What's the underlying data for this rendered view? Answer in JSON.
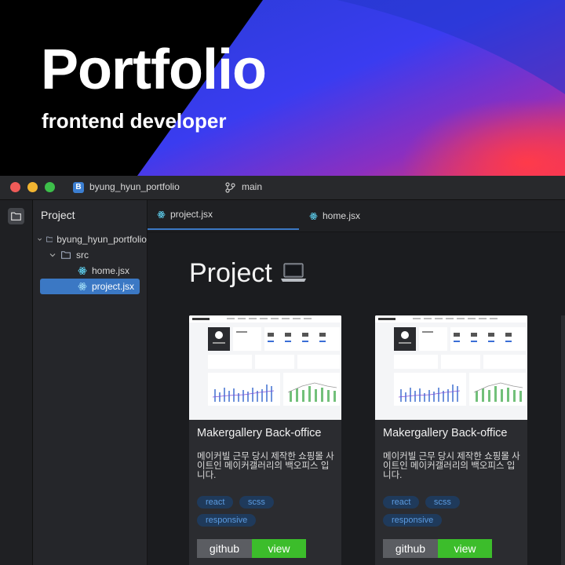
{
  "hero": {
    "title": "Portfolio",
    "subtitle": "frontend developer"
  },
  "titlebar": {
    "project_badge": "B",
    "project_name": "byung_hyun_portfolio",
    "branch": "main"
  },
  "sidebar": {
    "title": "Project",
    "tree": [
      {
        "label": "byung_hyun_portfolio",
        "type": "folder",
        "expanded": true
      },
      {
        "label": "src",
        "type": "folder",
        "expanded": true
      },
      {
        "label": "home.jsx",
        "type": "file"
      },
      {
        "label": "project.jsx",
        "type": "file",
        "selected": true
      }
    ]
  },
  "tabs": [
    {
      "label": "project.jsx",
      "active": true
    },
    {
      "label": "home.jsx",
      "active": false
    }
  ],
  "page": {
    "title": "Project"
  },
  "cards": [
    {
      "title": "Makergallery Back-office",
      "description": "메이커빌 근무 당시 제작한 쇼핑몰 사이트인 메이커갤러리의 백오피스 입니다.",
      "tags": [
        "react",
        "scss",
        "responsive"
      ],
      "github_label": "github",
      "view_label": "view"
    },
    {
      "title": "Makergallery Back-office",
      "description": "메이커빌 근무 당시 제작한 쇼핑몰 사이트인 메이커갤러리의 백오피스 입니다.",
      "tags": [
        "react",
        "scss",
        "responsive"
      ],
      "github_label": "github",
      "view_label": "view"
    }
  ],
  "colors": {
    "accent": "#3b78c4",
    "view_button": "#3cbd2b",
    "github_button": "#5b5d62",
    "tag_bg": "#1f3a5b",
    "tag_text": "#5b9be0"
  },
  "icons": [
    "folder-icon",
    "branch-icon",
    "react-icon",
    "laptop-icon",
    "chevron-down-icon"
  ]
}
